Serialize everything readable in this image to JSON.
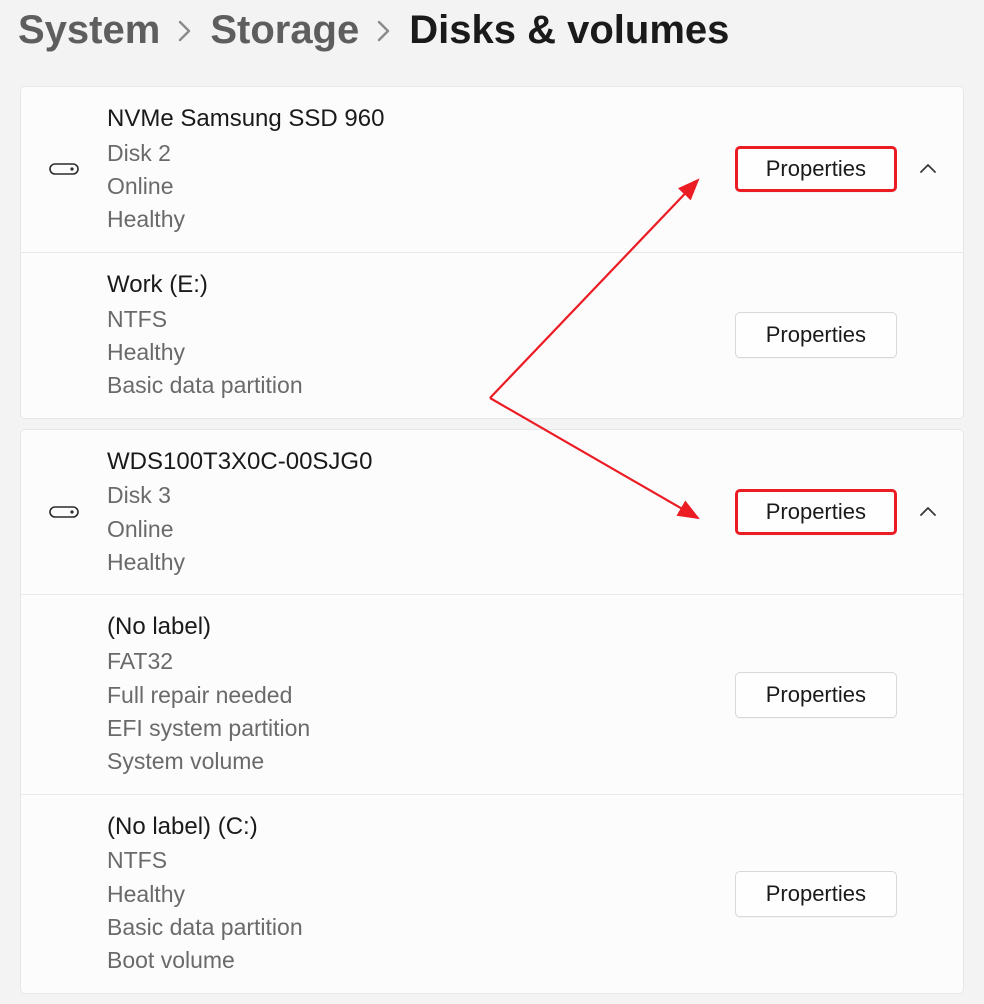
{
  "breadcrumb": {
    "items": [
      {
        "label": "System"
      },
      {
        "label": "Storage"
      },
      {
        "label": "Disks & volumes"
      }
    ]
  },
  "buttons": {
    "properties": "Properties"
  },
  "groups": [
    {
      "disk": {
        "name": "NVMe Samsung SSD 960",
        "lines": [
          "Disk 2",
          "Online",
          "Healthy"
        ],
        "button_highlighted": true
      },
      "volumes": [
        {
          "name": "Work (E:)",
          "lines": [
            "NTFS",
            "Healthy",
            "Basic data partition"
          ],
          "button_highlighted": false
        }
      ]
    },
    {
      "disk": {
        "name": "WDS100T3X0C-00SJG0",
        "lines": [
          "Disk 3",
          "Online",
          "Healthy"
        ],
        "button_highlighted": true
      },
      "volumes": [
        {
          "name": "(No label)",
          "lines": [
            "FAT32",
            "Full repair needed",
            "EFI system partition",
            "System volume"
          ],
          "button_highlighted": false
        },
        {
          "name": "(No label) (C:)",
          "lines": [
            "NTFS",
            "Healthy",
            "Basic data partition",
            "Boot volume"
          ],
          "button_highlighted": false
        }
      ]
    }
  ]
}
